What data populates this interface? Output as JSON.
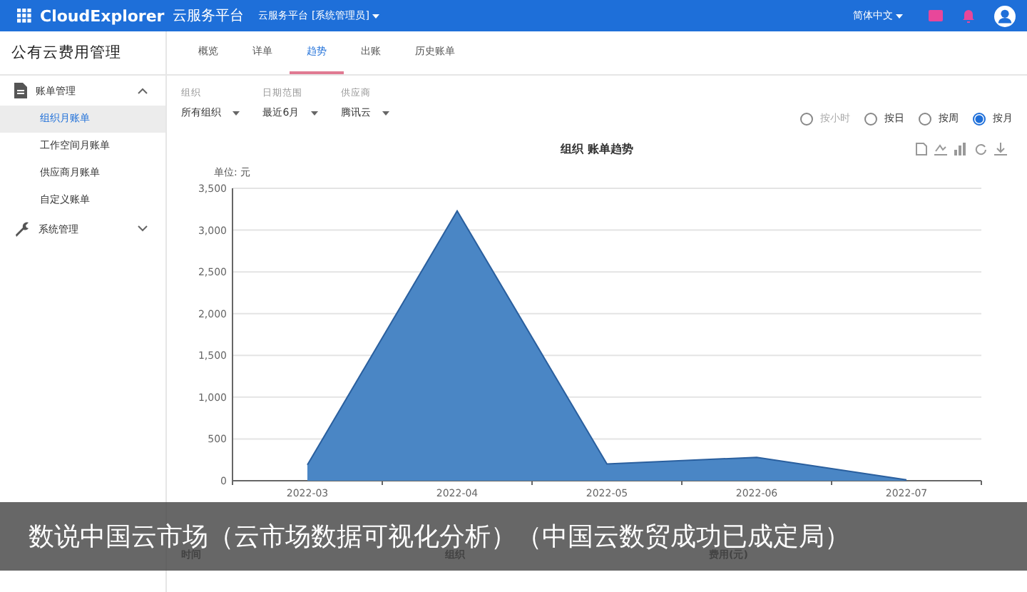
{
  "header": {
    "brand": "CloudExplorer",
    "platform": "云服务平台",
    "workspace": "云服务平台 [系统管理员]",
    "language": "简体中文"
  },
  "sidebar": {
    "title": "公有云费用管理",
    "items": [
      {
        "label": "账单管理",
        "kind": "doc",
        "expanded": true,
        "children": [
          {
            "label": "组织月账单",
            "selected": true
          },
          {
            "label": "工作空间月账单",
            "selected": false
          },
          {
            "label": "供应商月账单",
            "selected": false
          },
          {
            "label": "自定义账单",
            "selected": false
          }
        ]
      },
      {
        "label": "系统管理",
        "kind": "wrench",
        "expanded": false
      }
    ]
  },
  "tabs": [
    {
      "label": "概览",
      "selected": false
    },
    {
      "label": "详单",
      "selected": false
    },
    {
      "label": "趋势",
      "selected": true
    },
    {
      "label": "出账",
      "selected": false
    },
    {
      "label": "历史账单",
      "selected": false
    }
  ],
  "filters": [
    {
      "label": "组织",
      "value": "所有组织"
    },
    {
      "label": "日期范围",
      "value": "最近6月"
    },
    {
      "label": "供应商",
      "value": "腾讯云"
    }
  ],
  "granularity": [
    {
      "label": "按小时",
      "selected": false,
      "disabled": true
    },
    {
      "label": "按日",
      "selected": false,
      "disabled": false
    },
    {
      "label": "按周",
      "selected": false,
      "disabled": false
    },
    {
      "label": "按月",
      "selected": true,
      "disabled": false
    }
  ],
  "chart": {
    "unit": "单位: 元",
    "chart_data": {
      "type": "area",
      "title": "组织 账单趋势",
      "grid": true,
      "categories": [
        "2022-03",
        "2022-04",
        "2022-05",
        "2022-06",
        "2022-07"
      ],
      "series": [
        {
          "color": "#4a86c5",
          "values": [
            190,
            3230,
            200,
            280,
            10
          ]
        }
      ],
      "ylim": [
        0,
        3500
      ],
      "yticks": [
        {
          "value": 0,
          "label": "0"
        },
        {
          "value": 500,
          "label": "500"
        },
        {
          "value": 1000,
          "label": "1,000"
        },
        {
          "value": 1500,
          "label": "1,500"
        },
        {
          "value": 2000,
          "label": "2,000"
        },
        {
          "value": 2500,
          "label": "2,500"
        },
        {
          "value": 3000,
          "label": "3,000"
        },
        {
          "value": 3500,
          "label": "3,500"
        }
      ]
    }
  },
  "table": {
    "columns": [
      "时间",
      "组织",
      "费用(元)"
    ]
  },
  "caption": "数说中国云市场（云市场数据可视化分析）（中国云数贸成功已成定局）"
}
